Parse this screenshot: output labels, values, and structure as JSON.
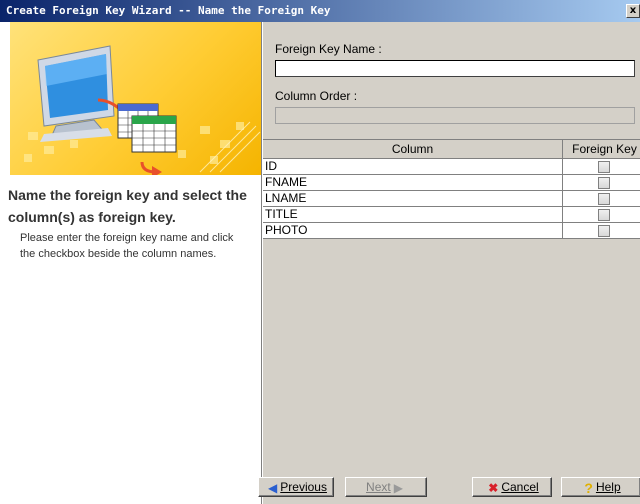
{
  "window": {
    "title": "Create Foreign Key Wizard -- Name the Foreign Key",
    "close_glyph": "x"
  },
  "left_panel": {
    "heading": "Name the foreign key and select the column(s) as foreign key.",
    "description": "Please enter the foreign key name and click the checkbox beside the column names.",
    "illustration_icon": "monitor-and-table-icon"
  },
  "form": {
    "fk_name_label": "Foreign Key Name :",
    "fk_name_value": "",
    "column_order_label": "Column Order :",
    "column_order_value": ""
  },
  "table": {
    "headers": [
      "Column",
      "Foreign Key"
    ],
    "rows": [
      {
        "column": "ID",
        "foreign_key": false
      },
      {
        "column": "FNAME",
        "foreign_key": false
      },
      {
        "column": "LNAME",
        "foreign_key": false
      },
      {
        "column": "TITLE",
        "foreign_key": false
      },
      {
        "column": "PHOTO",
        "foreign_key": false
      }
    ]
  },
  "buttons": {
    "previous": {
      "label": "Previous",
      "icon": "arrow-left-icon",
      "enabled": true
    },
    "next": {
      "label": "Next",
      "icon": "arrow-right-icon",
      "enabled": false
    },
    "cancel": {
      "label": "Cancel",
      "icon": "red-x-icon",
      "enabled": true
    },
    "help": {
      "label": "Help",
      "icon": "question-mark-icon",
      "enabled": true
    }
  },
  "colors": {
    "title_gradient_start": "#0a246a",
    "title_gradient_end": "#a6caf0",
    "illustration_yellow": "#ffcc33",
    "window_face": "#d4d0c8"
  }
}
